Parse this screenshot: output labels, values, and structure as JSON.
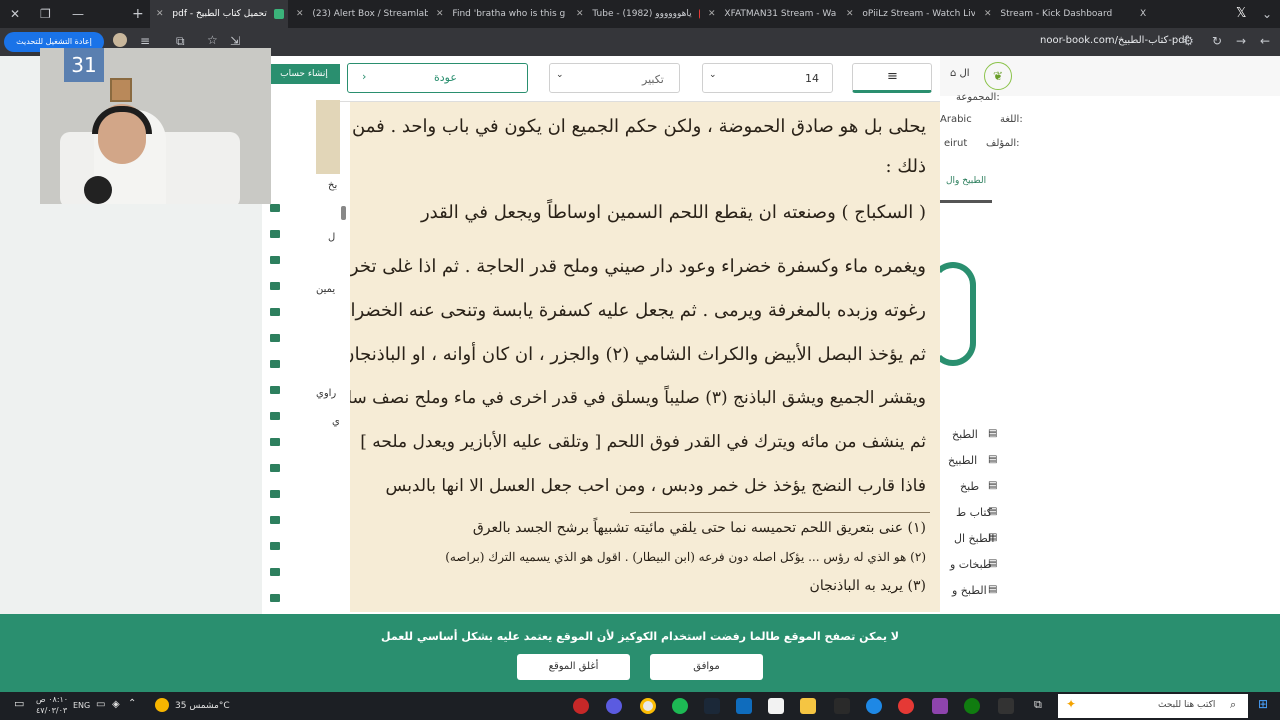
{
  "browser": {
    "tabs": [
      {
        "label": "pdf - تحميل كتاب الطبيخ",
        "active": true
      },
      {
        "label": "(23) Alert Box / Streamlab",
        "active": false
      },
      {
        "label": "Find 'bratha who is this g",
        "active": false
      },
      {
        "label": "Tube - (1982) ياهوووووو",
        "active": false
      },
      {
        "label": "XFATMAN31 Stream - Wa",
        "active": false
      },
      {
        "label": "oPiiLz Stream - Watch Liv",
        "active": false
      },
      {
        "label": "Stream - Kick Dashboard",
        "active": false
      },
      {
        "label": "X",
        "active": false
      }
    ],
    "update_button": "إعادة التشغيل للتحديث",
    "url": "noor-book.com/كتاب-الطبيخ-pdf"
  },
  "site": {
    "create_account": "إنشاء حساب",
    "meta_group": "المجموعة:",
    "meta_lang_label": "اللغة:",
    "meta_lang_value": "Arabic",
    "meta_publisher_label": "المؤلف:",
    "meta_publisher_value": "eirut",
    "category_chip": "الطبيخ وال",
    "left_fragments": [
      "بخ",
      "ل",
      "يمين",
      "راوي",
      "ي"
    ],
    "related": [
      "الطبخ",
      "الطبيخ",
      "طبخ",
      "كتاب ط",
      "الطبخ ال",
      "طبخات و",
      "الطبخ و"
    ]
  },
  "viewer": {
    "back_label": "عودة",
    "zoom_label": "تكبير",
    "page_number": "14",
    "menu_icon": "hamburger-icon"
  },
  "book": {
    "lines": [
      "يحلى بل هو صادق الحموضة ، ولكن حكم الجميع ان يكون في باب واحد . فمن",
      "ذلك :",
      "( السكباج ) وصنعته ان يقطع اللحم السمين اوساطاً ويجعل في القدر",
      "ويغمره ماء وكسفرة خضراء وعود دار صيني وملح قدر الحاجة . ثم اذا غلى تخرج",
      "رغوته وزبده بالمغرفة ويرمى . ثم يجعل عليه كسفرة يابسة وتنحى عنه الخضراء .",
      "ثم يؤخذ البصل الأبيض والكراث الشامي (٢) والجزر ، ان كان أوانه ، او الباذنجان",
      "ويقشر الجميع ويشق الباذنج (٣) صليباً ويسلق في قدر اخرى في ماء وملح نصف سلقة",
      "ثم ينشف من مائه ويترك في القدر فوق اللحم [ وتلقى عليه الأبازير ويعدل ملحه ]",
      "فاذا قارب النضج يؤخذ خل خمر ودبس ، ومن احب جعل العسل الا انها بالدبس"
    ],
    "footnotes": [
      "(١) عنى بتعريق اللحم تحميسه نما حتى يلقي مائيته تشبيهاً برشح الجسد بالعرق",
      "(٢) هو الذي له رؤس ... يؤكل اصله دون فرعه (ابن البيطار) . اقول هو الذي يسميه الترك (براصه)",
      "(٣) يريد به الباذنجان"
    ]
  },
  "cookie": {
    "message": "لا يمكن تصفح الموقع طالما رفضت استخدام الكوكيز لأن الموقع يعتمد عليه بشكل أساسي للعمل",
    "accept": "موافق",
    "close": "أغلق الموقع"
  },
  "taskbar": {
    "search_placeholder": "اكتب هنا للبحث",
    "weather": "مشمس 35°C",
    "lang": "ENG",
    "time": "٠٨:١٠ ص",
    "date": "٤٧/٠٣/٠٣"
  },
  "colors": {
    "accent": "#2a8f6f",
    "paper": "#f6ecd6",
    "browser_dark": "#202124"
  }
}
